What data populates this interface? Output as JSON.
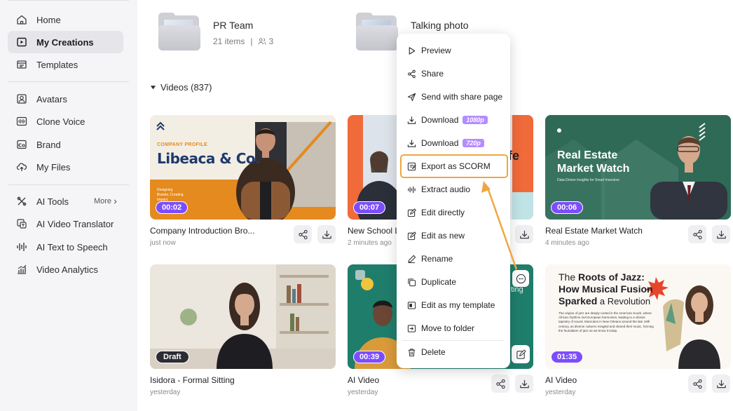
{
  "sidebar": {
    "items": [
      {
        "label": "Home",
        "icon": "home-icon"
      },
      {
        "label": "My Creations",
        "icon": "creations-icon",
        "active": true
      },
      {
        "label": "Templates",
        "icon": "templates-icon"
      },
      {
        "label": "Avatars",
        "icon": "avatar-icon"
      },
      {
        "label": "Clone Voice",
        "icon": "voice-icon"
      },
      {
        "label": "Brand",
        "icon": "brand-icon"
      },
      {
        "label": "My Files",
        "icon": "cloud-upload-icon"
      },
      {
        "label": "AI Tools",
        "icon": "tools-icon"
      },
      {
        "label": "AI Video Translator",
        "icon": "translate-icon"
      },
      {
        "label": "AI Text to Speech",
        "icon": "waveform-icon"
      },
      {
        "label": "Video Analytics",
        "icon": "analytics-icon"
      }
    ],
    "more_label": "More"
  },
  "folders": [
    {
      "title": "PR Team",
      "items": "21 items",
      "members": "3"
    },
    {
      "title": "Talking photo"
    }
  ],
  "section": {
    "label": "Videos (837)"
  },
  "cards": [
    {
      "title": "Company Introduction Bro...",
      "time": "just now",
      "badge": "00:02",
      "thumb_heading_small": "COMPANY PROFILE",
      "thumb_heading": "Libeaca & Co.",
      "thumb_sub": "Designing Brands, Creating Impact."
    },
    {
      "title": "New School L",
      "time": "2 minutes ago",
      "badge": "00:07",
      "thumb_fragment": "fe"
    },
    {
      "title": "Real Estate Market Watch",
      "time": "4 minutes ago",
      "badge": "00:06",
      "thumb_heading": "Real Estate Market Watch",
      "thumb_sub": "Data-Driven Insights for Smart Investors"
    },
    {
      "title": "Isidora - Formal Sitting",
      "time": "yesterday",
      "badge": "Draft"
    },
    {
      "title": "AI Video",
      "time": "yesterday",
      "badge": "00:39",
      "thumb_fragment": "ting"
    },
    {
      "title": "AI Video",
      "time": "yesterday",
      "badge": "01:35",
      "thumb_heading_a": "The ",
      "thumb_heading_b": "Roots",
      "thumb_heading_c": " of Jazz:",
      "thumb_heading_2": "How Musical Fusion",
      "thumb_heading_3a": "Sparked",
      "thumb_heading_3b": " a Revolution",
      "thumb_body": "The origins of jazz are deeply rooted in the American South, where African rhythms met European harmonies, leading to a vibrant tapestry of sound. Musicians in New Orleans around the late 19th century, as diverse cultures mingled and shared their music, forming the foundation of jazz as we know it today."
    }
  ],
  "menu": {
    "items": [
      {
        "label": "Preview",
        "icon": "play-icon"
      },
      {
        "label": "Share",
        "icon": "share-icon"
      },
      {
        "label": "Send with share page",
        "icon": "send-icon"
      },
      {
        "label": "Download",
        "icon": "download-icon",
        "quality": "1080p"
      },
      {
        "label": "Download",
        "icon": "download-icon",
        "quality": "720p"
      },
      {
        "label": "Export as SCORM",
        "icon": "scorm-icon",
        "highlighted": true
      },
      {
        "label": "Extract audio",
        "icon": "audio-icon"
      },
      {
        "label": "Edit directly",
        "icon": "edit-icon"
      },
      {
        "label": "Edit as new",
        "icon": "edit-new-icon"
      },
      {
        "label": "Rename",
        "icon": "rename-icon"
      },
      {
        "label": "Duplicate",
        "icon": "duplicate-icon"
      },
      {
        "label": "Edit as my template",
        "icon": "template-edit-icon"
      },
      {
        "label": "Move to folder",
        "icon": "move-folder-icon"
      },
      {
        "label": "Delete",
        "icon": "trash-icon"
      }
    ]
  },
  "colors": {
    "accent": "#7c4dff",
    "highlight": "#f0a640",
    "quality_badge": "#b58cff",
    "sidebar_bg": "#f5f5f7"
  }
}
